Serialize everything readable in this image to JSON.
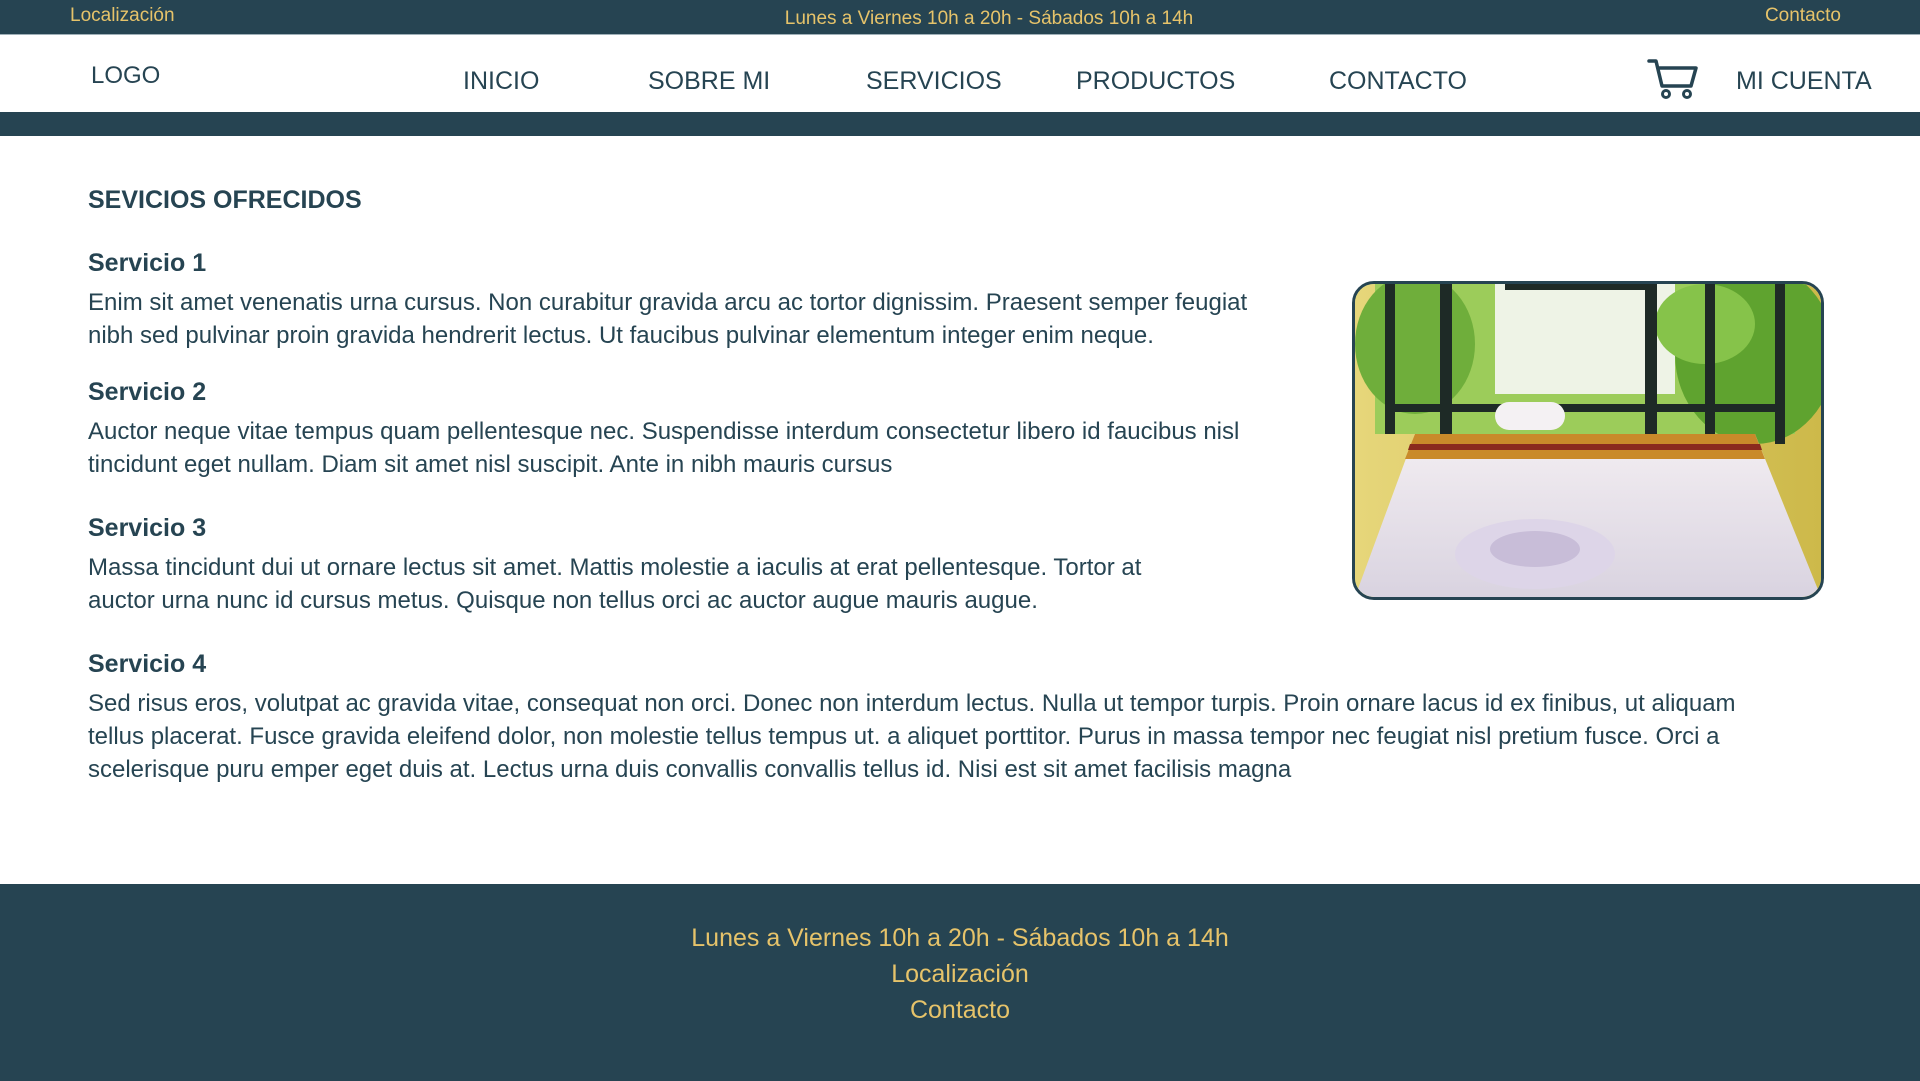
{
  "topbar": {
    "location": "Localización",
    "hours": "Lunes a Viernes 10h a 20h - Sábados 10h a 14h",
    "contact": "Contacto"
  },
  "nav": {
    "logo": "LOGO",
    "items": [
      "INICIO",
      "SOBRE MI",
      "SERVICIOS",
      "PRODUCTOS",
      "CONTACTO"
    ],
    "account": "MI CUENTA",
    "cart_icon": "shopping-cart-icon"
  },
  "main": {
    "section_title": "SEVICIOS OFRECIDOS",
    "services": [
      {
        "title": "Servicio 1",
        "text": "Enim sit amet venenatis urna cursus. Non curabitur gravida arcu ac tortor dignissim. Praesent semper feugiat nibh sed pulvinar proin gravida hendrerit lectus. Ut faucibus pulvinar elementum integer enim neque."
      },
      {
        "title": "Servicio 2",
        "text": "Auctor neque vitae tempus quam pellentesque nec. Suspendisse interdum consectetur libero id faucibus nisl tincidunt eget nullam. Diam sit amet nisl suscipit. Ante in nibh mauris cursus"
      },
      {
        "title": "Servicio 3",
        "text": "Massa tincidunt dui ut ornare lectus sit amet. Mattis molestie a iaculis at erat pellentesque. Tortor at auctor urna nunc id cursus metus. Quisque non tellus orci ac auctor augue mauris augue."
      },
      {
        "title": "Servicio 4",
        "text": "Sed risus eros, volutpat ac gravida vitae, consequat non orci. Donec non interdum lectus. Nulla ut tempor turpis. Proin ornare lacus id ex finibus, ut aliquam tellus placerat. Fusce gravida eleifend dolor, non molestie tellus tempus ut. a aliquet porttitor. Purus in massa tempor nec feugiat nisl pretium fusce. Orci a scelerisque puru emper eget duis at. Lectus urna duis convallis convallis tellus id. Nisi est sit amet facilisis magna"
      }
    ]
  },
  "footer": {
    "hours": "Lunes a Viernes 10h a 20h - Sábados 10h a 14h",
    "location": "Localización",
    "contact": "Contacto"
  },
  "colors": {
    "primary": "#264452",
    "accent": "#e6c36a",
    "background": "#ffffff"
  }
}
